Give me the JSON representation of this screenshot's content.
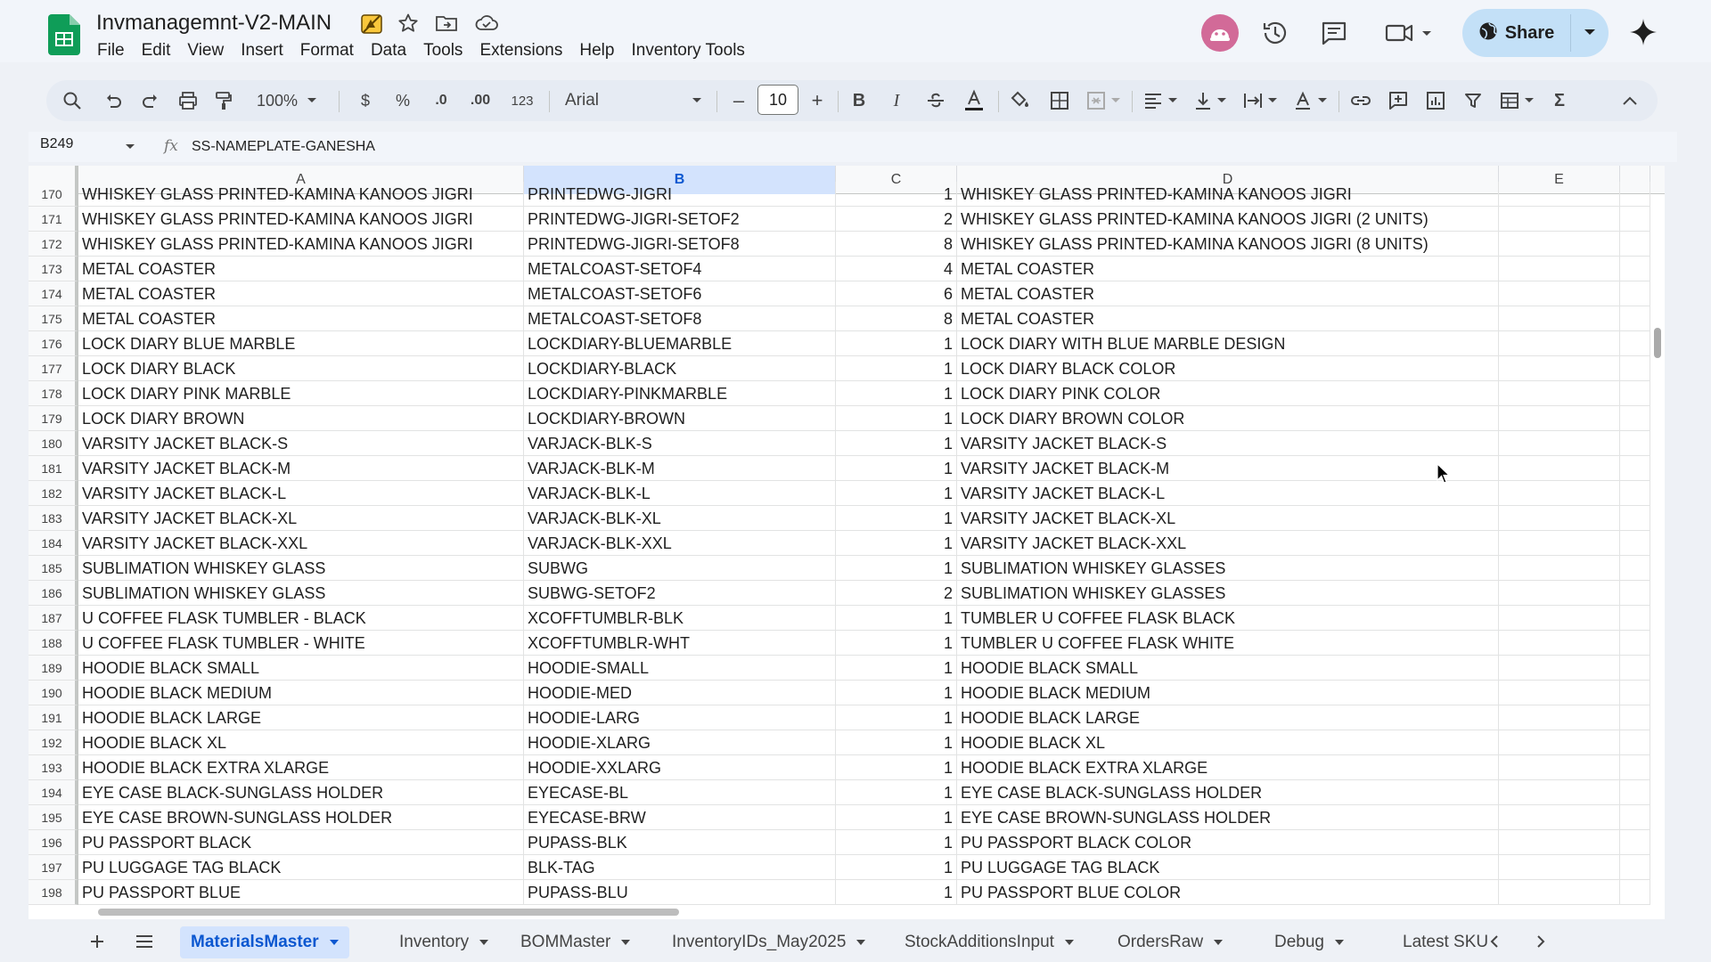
{
  "colors": {
    "accent": "#0b57d0",
    "selected_header": "#d3e3fd",
    "share_bg": "#c3e0f7",
    "sheets_green": "#0f9d58"
  },
  "document": {
    "title": "Invmanagemnt-V2-MAIN"
  },
  "menu": [
    "File",
    "Edit",
    "View",
    "Insert",
    "Format",
    "Data",
    "Tools",
    "Extensions",
    "Help",
    "Inventory Tools"
  ],
  "header": {
    "share_label": "Share"
  },
  "toolbar": {
    "zoom": "100%",
    "currency": "$",
    "percent": "%",
    "dec_decrease": ".0",
    "dec_increase": ".00",
    "number_format": "123",
    "font": "Arial",
    "font_size": "10",
    "minus": "–",
    "plus": "+",
    "bold": "B",
    "italic": "I",
    "sum": "Σ"
  },
  "formula_bar": {
    "cell_ref": "B249",
    "fx": "fx",
    "value": "SS-NAMEPLATE-GANESHA"
  },
  "columns": [
    {
      "id": "A"
    },
    {
      "id": "B"
    },
    {
      "id": "C"
    },
    {
      "id": "D"
    },
    {
      "id": "E"
    }
  ],
  "rows": [
    {
      "n": "170",
      "a": "WHISKEY GLASS PRINTED-KAMINA KANOOS JIGRI",
      "b": "PRINTEDWG-JIGRI",
      "c": "1",
      "d": "WHISKEY GLASS PRINTED-KAMINA KANOOS JIGRI"
    },
    {
      "n": "171",
      "a": "WHISKEY GLASS PRINTED-KAMINA KANOOS JIGRI",
      "b": "PRINTEDWG-JIGRI-SETOF2",
      "c": "2",
      "d": "WHISKEY GLASS PRINTED-KAMINA KANOOS JIGRI (2 UNITS)"
    },
    {
      "n": "172",
      "a": "WHISKEY GLASS PRINTED-KAMINA KANOOS JIGRI",
      "b": "PRINTEDWG-JIGRI-SETOF8",
      "c": "8",
      "d": "WHISKEY GLASS PRINTED-KAMINA KANOOS JIGRI (8 UNITS)"
    },
    {
      "n": "173",
      "a": "METAL COASTER",
      "b": "METALCOAST-SETOF4",
      "c": "4",
      "d": "METAL COASTER"
    },
    {
      "n": "174",
      "a": "METAL COASTER",
      "b": "METALCOAST-SETOF6",
      "c": "6",
      "d": "METAL COASTER"
    },
    {
      "n": "175",
      "a": "METAL COASTER",
      "b": "METALCOAST-SETOF8",
      "c": "8",
      "d": "METAL COASTER"
    },
    {
      "n": "176",
      "a": "LOCK DIARY BLUE MARBLE",
      "b": "LOCKDIARY-BLUEMARBLE",
      "c": "1",
      "d": "LOCK DIARY WITH BLUE MARBLE DESIGN"
    },
    {
      "n": "177",
      "a": "LOCK DIARY BLACK",
      "b": "LOCKDIARY-BLACK",
      "c": "1",
      "d": "LOCK DIARY BLACK COLOR"
    },
    {
      "n": "178",
      "a": "LOCK DIARY PINK MARBLE",
      "b": "LOCKDIARY-PINKMARBLE",
      "c": "1",
      "d": "LOCK DIARY PINK COLOR"
    },
    {
      "n": "179",
      "a": "LOCK DIARY BROWN",
      "b": "LOCKDIARY-BROWN",
      "c": "1",
      "d": "LOCK DIARY BROWN COLOR"
    },
    {
      "n": "180",
      "a": "VARSITY JACKET BLACK-S",
      "b": "VARJACK-BLK-S",
      "c": "1",
      "d": "VARSITY JACKET BLACK-S"
    },
    {
      "n": "181",
      "a": "VARSITY JACKET BLACK-M",
      "b": "VARJACK-BLK-M",
      "c": "1",
      "d": "VARSITY JACKET BLACK-M"
    },
    {
      "n": "182",
      "a": "VARSITY JACKET BLACK-L",
      "b": "VARJACK-BLK-L",
      "c": "1",
      "d": "VARSITY JACKET BLACK-L"
    },
    {
      "n": "183",
      "a": "VARSITY JACKET BLACK-XL",
      "b": "VARJACK-BLK-XL",
      "c": "1",
      "d": "VARSITY JACKET BLACK-XL"
    },
    {
      "n": "184",
      "a": "VARSITY JACKET BLACK-XXL",
      "b": "VARJACK-BLK-XXL",
      "c": "1",
      "d": "VARSITY JACKET BLACK-XXL"
    },
    {
      "n": "185",
      "a": "SUBLIMATION WHISKEY GLASS",
      "b": "SUBWG",
      "c": "1",
      "d": "SUBLIMATION WHISKEY GLASSES"
    },
    {
      "n": "186",
      "a": "SUBLIMATION WHISKEY GLASS",
      "b": "SUBWG-SETOF2",
      "c": "2",
      "d": "SUBLIMATION WHISKEY GLASSES"
    },
    {
      "n": "187",
      "a": "U COFFEE FLASK TUMBLER - BLACK",
      "b": "XCOFFTUMBLR-BLK",
      "c": "1",
      "d": "TUMBLER U COFFEE FLASK BLACK"
    },
    {
      "n": "188",
      "a": "U COFFEE FLASK  TUMBLER - WHITE",
      "b": "XCOFFTUMBLR-WHT",
      "c": "1",
      "d": "TUMBLER U COFFEE FLASK WHITE"
    },
    {
      "n": "189",
      "a": "HOODIE BLACK SMALL",
      "b": "HOODIE-SMALL",
      "c": "1",
      "d": "HOODIE BLACK SMALL"
    },
    {
      "n": "190",
      "a": "HOODIE BLACK MEDIUM",
      "b": "HOODIE-MED",
      "c": "1",
      "d": "HOODIE BLACK MEDIUM"
    },
    {
      "n": "191",
      "a": "HOODIE BLACK LARGE",
      "b": "HOODIE-LARG",
      "c": "1",
      "d": "HOODIE BLACK LARGE"
    },
    {
      "n": "192",
      "a": "HOODIE BLACK XL",
      "b": "HOODIE-XLARG",
      "c": "1",
      "d": "HOODIE BLACK XL"
    },
    {
      "n": "193",
      "a": "HOODIE BLACK EXTRA XLARGE",
      "b": "HOODIE-XXLARG",
      "c": "1",
      "d": "HOODIE BLACK EXTRA XLARGE"
    },
    {
      "n": "194",
      "a": "EYE CASE BLACK-SUNGLASS HOLDER",
      "b": "EYECASE-BL",
      "c": "1",
      "d": "EYE CASE BLACK-SUNGLASS HOLDER"
    },
    {
      "n": "195",
      "a": "EYE CASE BROWN-SUNGLASS HOLDER",
      "b": "EYECASE-BRW",
      "c": "1",
      "d": "EYE CASE BROWN-SUNGLASS HOLDER"
    },
    {
      "n": "196",
      "a": "PU PASSPORT BLACK",
      "b": "PUPASS-BLK",
      "c": "1",
      "d": "PU PASSPORT BLACK COLOR"
    },
    {
      "n": "197",
      "a": "PU LUGGAGE TAG BLACK",
      "b": "BLK-TAG",
      "c": "1",
      "d": "PU LUGGAGE TAG BLACK"
    },
    {
      "n": "198",
      "a": "PU PASSPORT BLUE",
      "b": "PUPASS-BLU",
      "c": "1",
      "d": "PU PASSPORT BLUE COLOR"
    }
  ],
  "sheets": [
    {
      "name": "MaterialsMaster",
      "active": true
    },
    {
      "name": "Inventory",
      "active": false
    },
    {
      "name": "BOMMaster",
      "active": false
    },
    {
      "name": "InventoryIDs_May2025",
      "active": false
    },
    {
      "name": "StockAdditionsInput",
      "active": false
    },
    {
      "name": "OrdersRaw",
      "active": false
    },
    {
      "name": "Debug",
      "active": false
    },
    {
      "name": "Latest SKU",
      "active": false
    }
  ]
}
